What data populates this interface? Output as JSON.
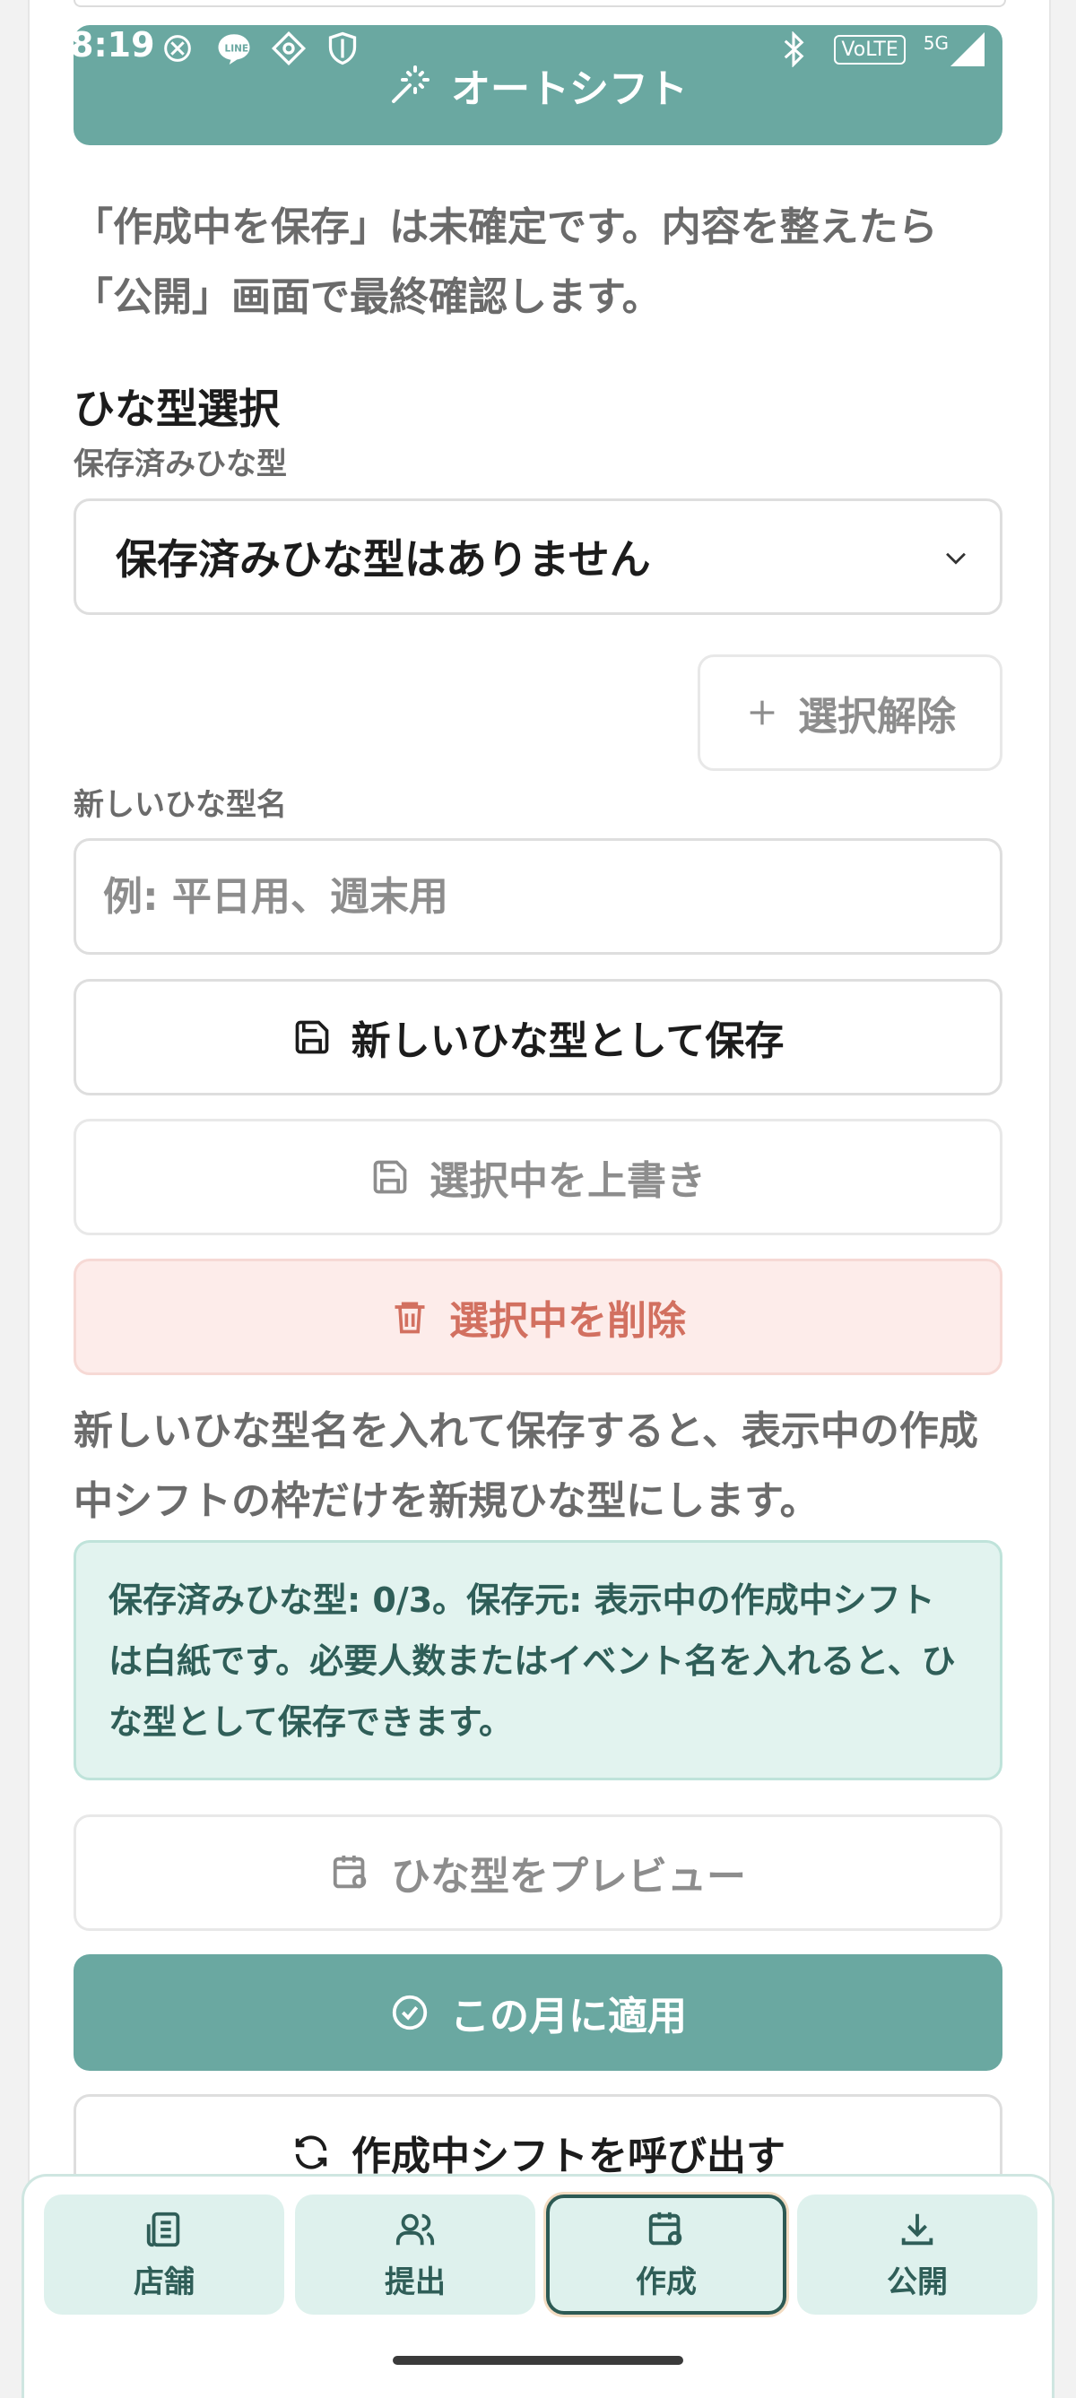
{
  "status_bar": {
    "time": "8:19",
    "left_icons": [
      "openai-icon",
      "line-icon",
      "app-icon",
      "shield-icon"
    ],
    "right_icons": [
      "bluetooth-icon",
      "volte-badge",
      "5g-icon",
      "signal-icon",
      "battery-icon"
    ],
    "volte_text": "VoLTE",
    "network_text": "5G"
  },
  "autoshift_button": {
    "label": "オートシフト",
    "icon": "magic-wand-icon"
  },
  "intro_text": "「作成中を保存」は未確定です。内容を整えたら「公開」画面で最終確認します。",
  "template_section": {
    "title": "ひな型選択",
    "saved_label": "保存済みひな型",
    "select_value": "保存済みひな型はありません",
    "deselect_label": "選択解除",
    "new_name_label": "新しいひな型名",
    "new_name_placeholder": "例: 平日用、週末用",
    "save_new_label": "新しいひな型として保存",
    "overwrite_label": "選択中を上書き",
    "delete_label": "選択中を削除",
    "help_text": "新しいひな型名を入れて保存すると、表示中の作成中シフトの枠だけを新規ひな型にします。",
    "info_text": "保存済みひな型: 0/3。保存元: 表示中の作成中シフトは白紙です。必要人数またはイベント名を入れると、ひな型として保存できます。",
    "preview_label": "ひな型をプレビュー",
    "apply_label": "この月に適用",
    "recall_label": "作成中シフトを呼び出す"
  },
  "bottom_nav": {
    "items": [
      {
        "label": "店舗",
        "icon": "store-icon",
        "active": false
      },
      {
        "label": "提出",
        "icon": "users-icon",
        "active": false
      },
      {
        "label": "作成",
        "icon": "calendar-settings-icon",
        "active": true
      },
      {
        "label": "公開",
        "icon": "download-icon",
        "active": false
      }
    ]
  },
  "colors": {
    "primary": "#6aa8a1",
    "danger_text": "#d27060",
    "danger_bg": "#fdecea",
    "info_bg": "#e2f3ef",
    "nav_active_border": "#2d5a54"
  }
}
